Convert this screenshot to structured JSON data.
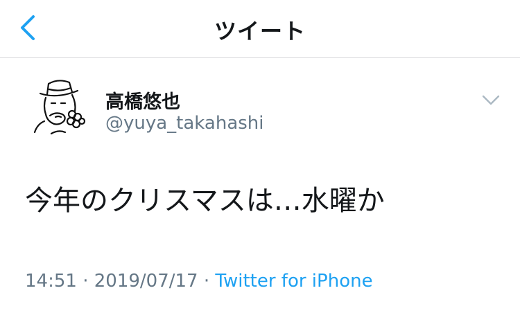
{
  "nav": {
    "title": "ツイート",
    "back_icon": "chevron-left-icon"
  },
  "colors": {
    "accent": "#1da1f2",
    "text_primary": "#14171a",
    "text_secondary": "#657786",
    "divider": "#d6d6da"
  },
  "tweet": {
    "display_name": "高橋悠也",
    "handle": "@yuya_takahashi",
    "text": "今年のクリスマスは…水曜か",
    "time": "14:51",
    "separator": " · ",
    "date": "2019/07/17",
    "source": "Twitter for iPhone",
    "more_icon": "chevron-down-icon",
    "avatar_icon": "avatar-illustration-hat-icon"
  }
}
